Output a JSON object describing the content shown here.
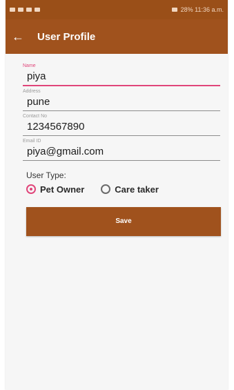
{
  "status_bar": {
    "right_text": "28% 11:36 a.m."
  },
  "app_bar": {
    "back_icon": "arrow-left-icon",
    "title": "User Profile"
  },
  "form": {
    "fields": [
      {
        "label": "Name",
        "value": "piya",
        "active": true
      },
      {
        "label": "Address",
        "value": "pune",
        "active": false
      },
      {
        "label": "Contact No",
        "value": "1234567890",
        "active": false
      },
      {
        "label": "Email ID",
        "value": "piya@gmail.com",
        "active": false
      }
    ],
    "user_type_label": "User Type:",
    "options": [
      {
        "label": "Pet Owner",
        "checked": true
      },
      {
        "label": "Care taker",
        "checked": false
      }
    ],
    "save_label": "Save"
  },
  "colors": {
    "primary": "#a0521d",
    "accent": "#e0457a"
  }
}
